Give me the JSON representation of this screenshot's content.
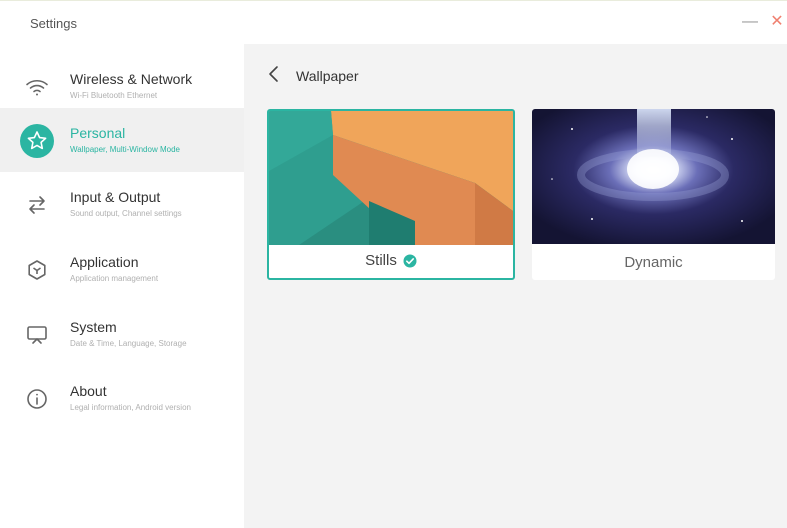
{
  "window": {
    "title": "Settings",
    "minimize_glyph": "—",
    "close_glyph": "✕"
  },
  "sidebar": {
    "items": [
      {
        "label": "Wireless & Network",
        "sub": "Wi-Fi Bluetooth Ethernet",
        "icon": "wifi-icon"
      },
      {
        "label": "Personal",
        "sub": "Wallpaper, Multi-Window Mode",
        "icon": "star-icon",
        "active": true
      },
      {
        "label": "Input & Output",
        "sub": "Sound output, Channel settings",
        "icon": "swap-arrows-icon"
      },
      {
        "label": "Application",
        "sub": "Application management",
        "icon": "hexagon-icon"
      },
      {
        "label": "System",
        "sub": "Date & Time, Language, Storage",
        "icon": "monitor-icon"
      },
      {
        "label": "About",
        "sub": "Legal information, Android version",
        "icon": "info-icon"
      }
    ]
  },
  "main": {
    "title": "Wallpaper",
    "cards": [
      {
        "label": "Stills",
        "selected": true
      },
      {
        "label": "Dynamic",
        "selected": false
      }
    ]
  },
  "colors": {
    "accent": "#2bb5a2",
    "close": "#f08070"
  }
}
